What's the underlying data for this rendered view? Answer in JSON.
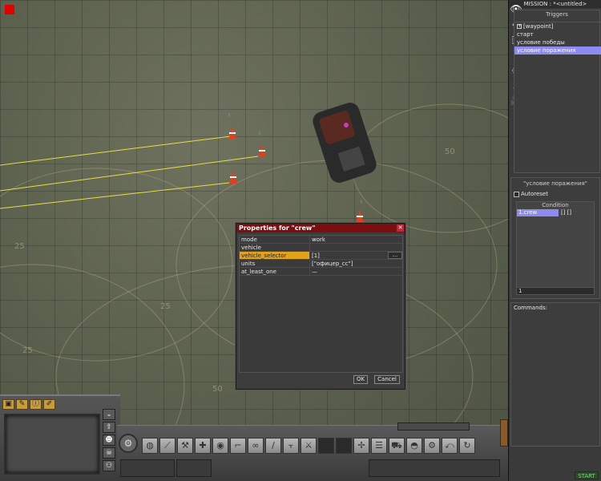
{
  "window": {
    "mission_title": "MISSION : *<untitled>"
  },
  "tools": [
    {
      "name": "eye-icon",
      "glyph": "👁"
    },
    {
      "name": "tag-icon",
      "glyph": "◈"
    },
    {
      "name": "selection-icon",
      "glyph": "⬚"
    },
    {
      "name": "flag-icon",
      "glyph": "⚑"
    },
    {
      "name": "circle-icon",
      "glyph": "◌"
    },
    {
      "name": "step-icon",
      "glyph": "⎍"
    },
    {
      "name": "camera-icon",
      "glyph": "🎥"
    },
    {
      "name": "arrow-up-icon",
      "glyph": "⇡"
    }
  ],
  "triggers": {
    "title": "Triggers",
    "items": [
      {
        "label": "[waypoint]",
        "expander": "+",
        "selected": false
      },
      {
        "label": "старт",
        "selected": false
      },
      {
        "label": "условие победы",
        "selected": false
      },
      {
        "label": "условие поражения",
        "selected": true
      }
    ]
  },
  "trigger_detail": {
    "title": "\"условие поражения\"",
    "autoreset_label": "Autoreset",
    "autoreset_checked": false,
    "condition_title": "Condition",
    "conditions": [
      {
        "name": "1.crew",
        "args": "[] []"
      }
    ],
    "condition_input": "1",
    "commands_label": "Commands:"
  },
  "start_label": "START",
  "dialog": {
    "title": "Properties for \"crew\"",
    "close_glyph": "✕",
    "rows": [
      {
        "key": "mode",
        "value": "work",
        "highlight": false,
        "ellipsis": false
      },
      {
        "key": "vehicle",
        "value": "",
        "highlight": false,
        "ellipsis": false
      },
      {
        "key": "vehicle_selector",
        "value": "[1]",
        "highlight": true,
        "ellipsis": true
      },
      {
        "key": "units",
        "value": "[\"офицер_сс\"]",
        "highlight": false,
        "ellipsis": false
      },
      {
        "key": "at_least_one",
        "value": "—",
        "highlight": false,
        "ellipsis": false
      }
    ],
    "ellipsis_label": "...",
    "ok_label": "OK",
    "cancel_label": "Cancel"
  },
  "hud_icons": [
    {
      "name": "video-icon",
      "glyph": "▣"
    },
    {
      "name": "wrench-icon",
      "glyph": "✎"
    },
    {
      "name": "info-icon",
      "glyph": "ⓘ"
    },
    {
      "name": "pencil-icon",
      "glyph": "✐"
    }
  ],
  "side_buttons": [
    {
      "name": "chevron-down-icon",
      "glyph": "⌄"
    },
    {
      "name": "up-arrow-icon",
      "glyph": "⇧"
    },
    {
      "name": "soldier-icon",
      "glyph": "☻"
    },
    {
      "name": "skull-icon",
      "glyph": "☠"
    },
    {
      "name": "team-icon",
      "glyph": "⚇"
    }
  ],
  "toolbar_buttons": [
    {
      "name": "grenade-icon",
      "glyph": "◍",
      "dark": false
    },
    {
      "name": "knife-icon",
      "glyph": "⟋",
      "dark": false
    },
    {
      "name": "wrench-tool-icon",
      "glyph": "⚒",
      "dark": false
    },
    {
      "name": "plus-icon",
      "glyph": "✚",
      "dark": false
    },
    {
      "name": "eye-tool-icon",
      "glyph": "◉",
      "dark": false
    },
    {
      "name": "rifle-icon",
      "glyph": "⌐",
      "dark": false
    },
    {
      "name": "binoculars-icon",
      "glyph": "∞",
      "dark": false
    },
    {
      "name": "bayonet-icon",
      "glyph": "/",
      "dark": false
    },
    {
      "name": "pistol-icon",
      "glyph": "⫟",
      "dark": false
    },
    {
      "name": "hammer-icon",
      "glyph": "⚔",
      "dark": false
    },
    {
      "name": "empty-slot-icon",
      "glyph": "",
      "dark": true
    },
    {
      "name": "empty-slot-icon-2",
      "glyph": "",
      "dark": true
    },
    {
      "name": "medkit-icon",
      "glyph": "✢",
      "dark": false
    },
    {
      "name": "stack-icon",
      "glyph": "☰",
      "dark": false
    },
    {
      "name": "vehicle-icon",
      "glyph": "⛟",
      "dark": false
    },
    {
      "name": "helmet-icon",
      "glyph": "◓",
      "dark": false
    },
    {
      "name": "tools-icon",
      "glyph": "⚙",
      "dark": false
    },
    {
      "name": "turn-icon",
      "glyph": "⤺",
      "dark": false
    },
    {
      "name": "cycle-icon",
      "glyph": "↻",
      "dark": false
    }
  ],
  "map_labels": [
    "3",
    "1",
    "2",
    "5",
    "25",
    "50",
    "25",
    "50",
    "25"
  ]
}
